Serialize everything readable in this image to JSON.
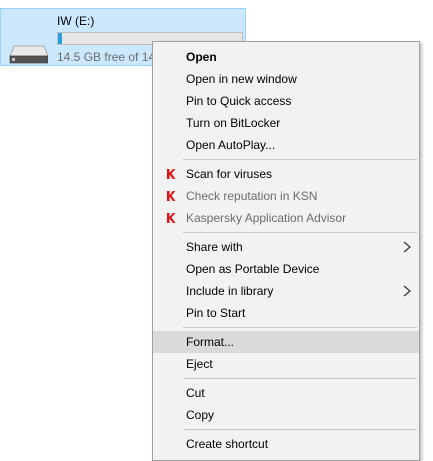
{
  "drive": {
    "name": "IW (E:)",
    "space_text": "14.5 GB free of 14",
    "used_fraction": 0.02,
    "icon": "drive-icon"
  },
  "menu": {
    "open": "Open",
    "open_new_window": "Open in new window",
    "pin_quick_access": "Pin to Quick access",
    "bitlocker": "Turn on BitLocker",
    "autoplay": "Open AutoPlay...",
    "scan": "Scan for viruses",
    "check_rep": "Check reputation in KSN",
    "kaspersky": "Kaspersky Application Advisor",
    "share_with": "Share with",
    "portable": "Open as Portable Device",
    "include_library": "Include in library",
    "pin_start": "Pin to Start",
    "format": "Format...",
    "eject": "Eject",
    "cut": "Cut",
    "copy": "Copy",
    "create_shortcut": "Create shortcut"
  },
  "colors": {
    "kaspersky_red": "#d11",
    "highlight": "#dadada",
    "selection": "#cce8ff"
  }
}
